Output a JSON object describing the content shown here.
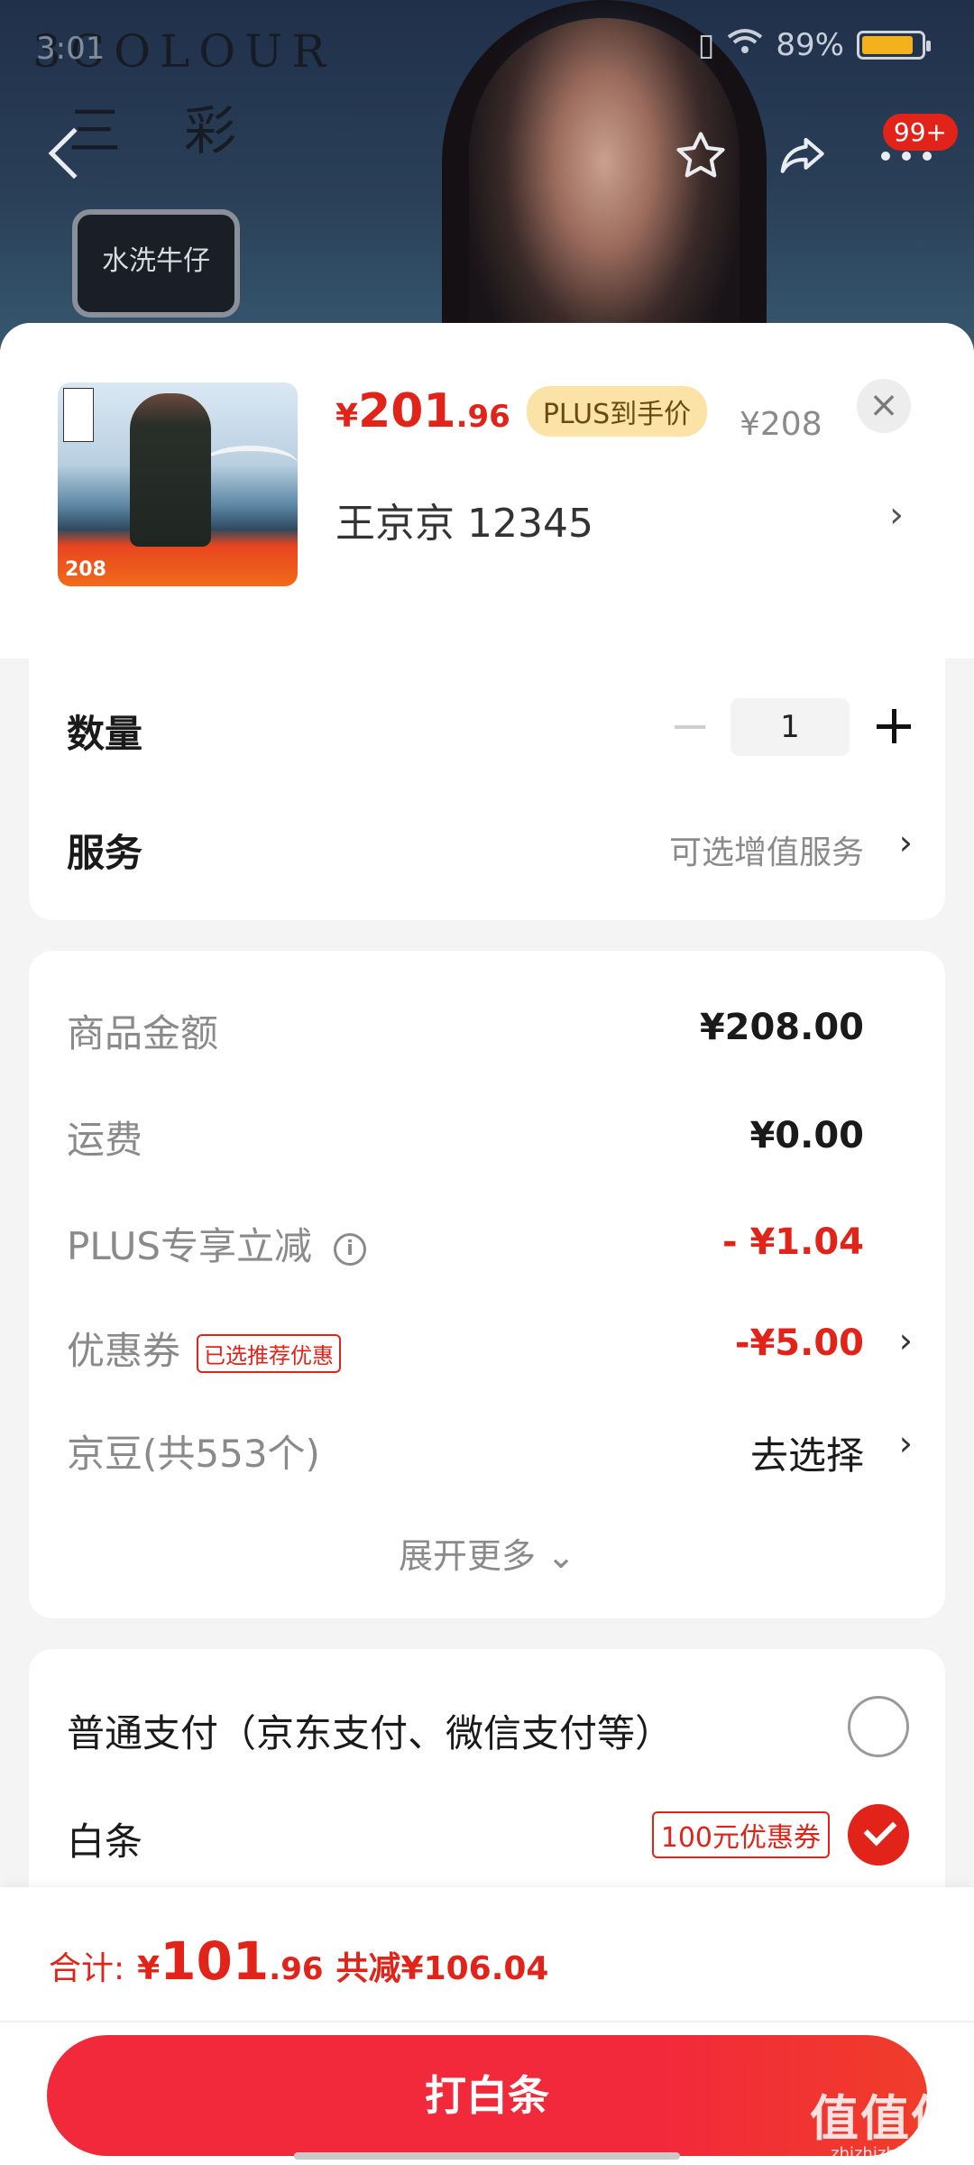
{
  "background": {
    "status_time": "3:01",
    "battery": "89%",
    "brand_latin": "3COLOUR",
    "brand_cn": "三彩",
    "cart_badge": "99+",
    "tag": "水洗牛仔"
  },
  "product": {
    "thumb_price": "208",
    "price_symbol": "¥",
    "price_int": "201",
    "price_dec": ".96",
    "plus_tag": "PLUS到手价",
    "original_price": "¥208",
    "variant": "王京京  12345"
  },
  "options": {
    "quantity_label": "数量",
    "quantity_value": "1",
    "service_label": "服务",
    "service_value": "可选增值服务"
  },
  "fees": {
    "goods_label": "商品金额",
    "goods_value": "¥208.00",
    "shipping_label": "运费",
    "shipping_value": "¥0.00",
    "plus_label": "PLUS专享立减",
    "plus_value": "- ¥1.04",
    "coupon_label": "优惠券",
    "coupon_tag": "已选推荐优惠",
    "coupon_value": "-¥5.00",
    "jingdou_label": "京豆(共553个)",
    "jingdou_value": "去选择",
    "expand": "展开更多 ⌄"
  },
  "payment": {
    "normal_label": "普通支付（京东支付、微信支付等）",
    "baitiao_label": "白条",
    "baitiao_coupon": "100元优惠券"
  },
  "footer": {
    "total_label": "合计:",
    "total_symbol": "¥",
    "total_int": "101",
    "total_dec": ".96",
    "saved": "共减¥106.04",
    "pay_button": "打白条"
  },
  "watermark": {
    "big": "值值值",
    "small": "zhizhizhi.com"
  },
  "colors": {
    "accent": "#e2231a",
    "plus_tag_bg": "#fbe3a8",
    "battery": "#f3b21b"
  }
}
